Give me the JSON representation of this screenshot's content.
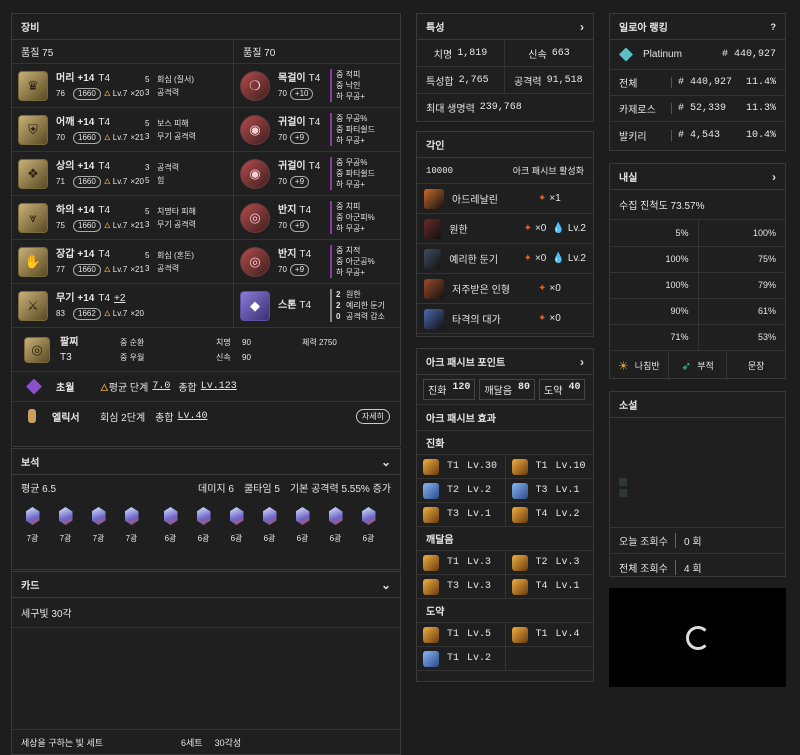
{
  "equipment": {
    "title": "장비",
    "left_quality": "품질 75",
    "right_quality": "품질 70",
    "armor": [
      {
        "name": "머리",
        "plus": "+14",
        "tier": "T4",
        "quality": "76",
        "ilvl": "1660",
        "lv": "Lv.7",
        "count": "×20",
        "e1n": "5",
        "e1": "회심 (질서)",
        "e2n": "3",
        "e2": "공격력"
      },
      {
        "name": "어깨",
        "plus": "+14",
        "tier": "T4",
        "quality": "70",
        "ilvl": "1660",
        "lv": "Lv.7",
        "count": "×21",
        "e1n": "5",
        "e1": "보스 피해",
        "e2n": "3",
        "e2": "무기 공격력"
      },
      {
        "name": "상의",
        "plus": "+14",
        "tier": "T4",
        "quality": "71",
        "ilvl": "1660",
        "lv": "Lv.7",
        "count": "×20",
        "e1n": "3",
        "e1": "공격력",
        "e2n": "5",
        "e2": "힘"
      },
      {
        "name": "하의",
        "plus": "+14",
        "tier": "T4",
        "quality": "75",
        "ilvl": "1660",
        "lv": "Lv.7",
        "count": "×21",
        "e1n": "5",
        "e1": "치명타 피해",
        "e2n": "3",
        "e2": "무기 공격력"
      },
      {
        "name": "장갑",
        "plus": "+14",
        "tier": "T4",
        "quality": "77",
        "ilvl": "1660",
        "lv": "Lv.7",
        "count": "×21",
        "e1n": "5",
        "e1": "회심 (혼돈)",
        "e2n": "3",
        "e2": "공격력"
      },
      {
        "name": "무기",
        "plus": "+14",
        "tier": "T4",
        "extra": "+2",
        "quality": "83",
        "ilvl": "1662",
        "lv": "Lv.7",
        "count": "×20",
        "e1n": "",
        "e1": "",
        "e2n": "",
        "e2": ""
      }
    ],
    "accessories": [
      {
        "name": "목걸이",
        "tier": "T4",
        "quality": "70",
        "bonus": "+10",
        "l1": "중 적피",
        "l2": "중 낙인",
        "l3": "하 무공+"
      },
      {
        "name": "귀걸이",
        "tier": "T4",
        "quality": "70",
        "bonus": "+9",
        "l1": "중 무공%",
        "l2": "중 파티쉴드",
        "l3": "하 무공+"
      },
      {
        "name": "귀걸이",
        "tier": "T4",
        "quality": "70",
        "bonus": "+9",
        "l1": "중 무공%",
        "l2": "중 파티쉴드",
        "l3": "하 무공+"
      },
      {
        "name": "반지",
        "tier": "T4",
        "quality": "70",
        "bonus": "+9",
        "l1": "중 치피",
        "l2": "중 아군피%",
        "l3": "하 무공+"
      },
      {
        "name": "반지",
        "tier": "T4",
        "quality": "70",
        "bonus": "+9",
        "l1": "중 치적",
        "l2": "중 아군공%",
        "l3": "하 무공+"
      }
    ],
    "stone": {
      "name": "스톤",
      "tier": "T4",
      "l1n": "2",
      "l1": "원한",
      "l2n": "2",
      "l2": "예리한 둔기",
      "l3n": "0",
      "l3": "공격력 감소"
    },
    "bracelet": {
      "name": "팔찌",
      "tier": "T3",
      "a": "중 순환",
      "b": "중 우월",
      "c": "치명",
      "cv": "90",
      "d": "신속",
      "dv": "90",
      "e": "체력",
      "ev": "2750"
    },
    "transcend": {
      "name": "초월",
      "avg_label": "평균 단계",
      "avg": "7.0",
      "total_label": "총합",
      "total": "Lv.123"
    },
    "elixir": {
      "name": "엘릭서",
      "set": "회심 2단계",
      "total_label": "총합",
      "total": "Lv.40",
      "detail": "자세히"
    }
  },
  "gems": {
    "title": "보석",
    "avg": "평균 6.5",
    "dmg": "데미지 6",
    "cd": "쿨타임 5",
    "base": "기본 공격력 5.55% 증가",
    "items": [
      "7광",
      "7광",
      "7광",
      "7광",
      "6광",
      "6광",
      "6광",
      "6광",
      "6광",
      "6광",
      "6광"
    ]
  },
  "cards": {
    "title": "카드",
    "set": "세구빛 30각",
    "footer_name": "세상을 구하는 빛 세트",
    "footer_set": "6세트",
    "footer_awake": "30각성"
  },
  "stats": {
    "title": "특성",
    "crit_l": "치명",
    "crit": "1,819",
    "swift_l": "신속",
    "swift": "663",
    "sum_l": "특성합",
    "sum": "2,765",
    "atk_l": "공격력",
    "atk": "91,518",
    "hp_l": "최대 생명력",
    "hp": "239,768"
  },
  "engravings": {
    "title": "각인",
    "points": "10000",
    "ark_active": "아크 패시브 활성화",
    "items": [
      {
        "name": "아드레날린",
        "fire": "×1",
        "ice": "",
        "lv": ""
      },
      {
        "name": "원한",
        "fire": "×0",
        "ice": "",
        "lv": "Lv.2"
      },
      {
        "name": "예리한 둔기",
        "fire": "×0",
        "ice": "",
        "lv": "Lv.2"
      },
      {
        "name": "저주받은 인형",
        "fire": "×0",
        "ice": "",
        "lv": ""
      },
      {
        "name": "타격의 대가",
        "fire": "×0",
        "ice": "",
        "lv": ""
      }
    ]
  },
  "ark": {
    "title": "아크 패시브 포인트",
    "evo_l": "진화",
    "evo": "120",
    "enl_l": "깨달음",
    "enl": "80",
    "leap_l": "도약",
    "leap": "40",
    "effects": "아크 패시브 효과",
    "evolution": "진화",
    "enlight": "깨달음",
    "leapt": "도약",
    "evo_items": [
      [
        "T1",
        "Lv.30"
      ],
      [
        "T1",
        "Lv.10"
      ],
      [
        "T2",
        "Lv.2"
      ],
      [
        "T3",
        "Lv.1"
      ],
      [
        "T3",
        "Lv.1"
      ],
      [
        "T4",
        "Lv.2"
      ]
    ],
    "enl_items": [
      [
        "T1",
        "Lv.3"
      ],
      [
        "T2",
        "Lv.3"
      ],
      [
        "T3",
        "Lv.3"
      ],
      [
        "T4",
        "Lv.1"
      ]
    ],
    "leap_items": [
      [
        "T1",
        "Lv.5"
      ],
      [
        "T1",
        "Lv.4"
      ],
      [
        "T1",
        "Lv.2"
      ]
    ]
  },
  "ranking": {
    "title": "일로아 랭킹",
    "help": "?",
    "tier": "Platinum",
    "tier_rank": "# 440,927",
    "rows": [
      {
        "l": "전체",
        "r": "# 440,927",
        "p": "11.4%"
      },
      {
        "l": "카제로스",
        "r": "# 52,339",
        "p": "11.3%"
      },
      {
        "l": "발키리",
        "r": "# 4,543",
        "p": "10.4%"
      }
    ]
  },
  "interior": {
    "title": "내실",
    "progress": "수집 진척도 73.57%",
    "rows": [
      [
        "5%",
        "100%"
      ],
      [
        "100%",
        "75%"
      ],
      [
        "100%",
        "79%"
      ],
      [
        "90%",
        "61%"
      ],
      [
        "71%",
        "53%"
      ]
    ],
    "tabs": [
      "나침반",
      "부적",
      "문장"
    ]
  },
  "social": {
    "title": "소설",
    "today_l": "오늘 조회수",
    "today": "0 회",
    "total_l": "전체 조회수",
    "total": "4 회"
  }
}
